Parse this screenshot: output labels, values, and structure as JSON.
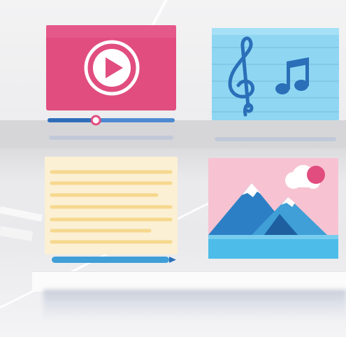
{
  "tiles": [
    {
      "name": "video",
      "icon": "play-icon",
      "color": "#e14d7f"
    },
    {
      "name": "music",
      "icon": "music-notes-icon",
      "color": "#8fd6f3"
    },
    {
      "name": "document",
      "icon": "text-lines-icon",
      "color": "#fbf0d4"
    },
    {
      "name": "image",
      "icon": "mountain-landscape-icon",
      "color": "#f7c3d3"
    }
  ],
  "video": {
    "progress": 0.38
  }
}
